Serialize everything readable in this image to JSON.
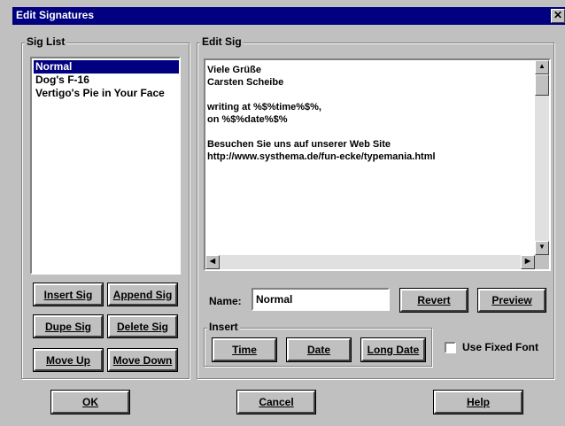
{
  "window": {
    "title": "Edit Signatures"
  },
  "sig_list": {
    "label": "Sig List",
    "items": [
      "Normal",
      "Dog's F-16",
      "Vertigo's Pie in Your Face"
    ],
    "selected": 0,
    "buttons": {
      "insert": "Insert Sig",
      "append": "Append Sig",
      "dupe": "Dupe Sig",
      "delete": "Delete Sig",
      "move_up": "Move Up",
      "move_down": "Move Down"
    }
  },
  "edit_sig": {
    "label": "Edit Sig",
    "lines": [
      "Viele Grüße",
      "Carsten Scheibe",
      "",
      "writing at %$%time%$%,",
      "on %$%date%$%",
      "",
      "Besuchen Sie uns auf unserer Web Site",
      "http://www.systhema.de/fun-ecke/typemania.html"
    ],
    "name_label": "Name:",
    "name_value": "Normal",
    "revert": "Revert",
    "preview": "Preview",
    "insert_label": "Insert",
    "insert_buttons": {
      "time": "Time",
      "date": "Date",
      "long_date": "Long Date"
    },
    "fixed_font_label": "Use Fixed Font",
    "fixed_font_checked": false
  },
  "footer": {
    "ok": "OK",
    "cancel": "Cancel",
    "help": "Help"
  }
}
